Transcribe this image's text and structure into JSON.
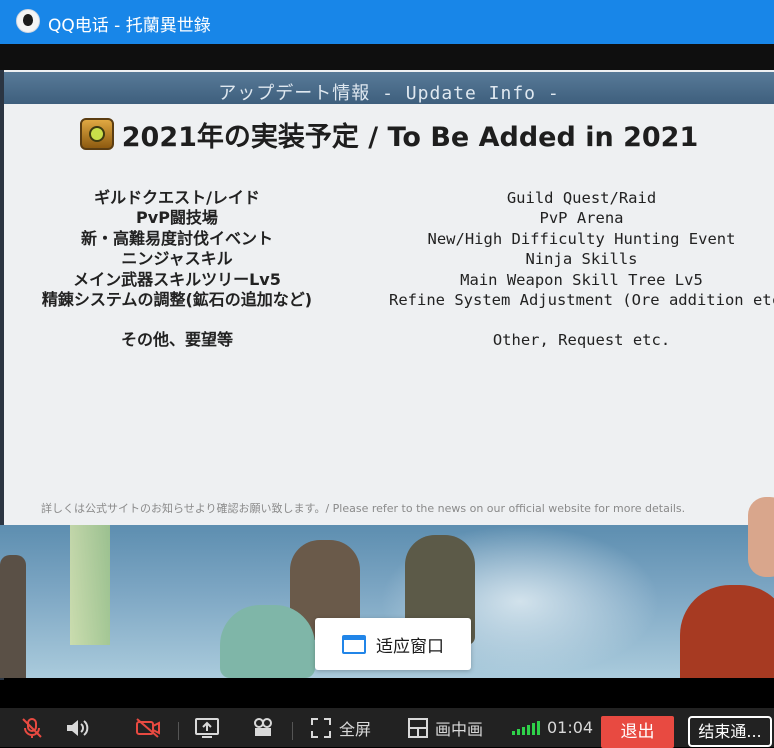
{
  "window": {
    "title": "QQ电话 - 托蘭異世錄"
  },
  "slide": {
    "header": "アップデート情報 - Update Info -",
    "title": "2021年の実装予定 / To Be Added in 2021",
    "items_jp": [
      "ギルドクエスト/レイド",
      "PvP闘技場",
      "新・高難易度討伐イベント",
      "ニンジャスキル",
      "メイン武器スキルツリーLv5",
      "精錬システムの調整(鉱石の追加など)"
    ],
    "items_en": [
      "Guild Quest/Raid",
      "PvP Arena",
      "New/High Difficulty Hunting Event",
      "Ninja Skills",
      "Main Weapon Skill Tree Lv5",
      "Refine System Adjustment (Ore addition etc.)"
    ],
    "other_jp": "その他、要望等",
    "other_en": "Other, Request etc.",
    "footnote": "詳しくは公式サイトのお知らせより確認お願い致します。/ Please refer to the news on our official website for more details."
  },
  "fit_window_label": "适应窗口",
  "toolbar": {
    "fullscreen_label": "全屏",
    "pip_label": "画中画",
    "duration": "01:04",
    "exit_label": "退出",
    "end_label": "结束通..."
  },
  "colors": {
    "titlebar": "#1886e8",
    "exit": "#e84a41",
    "signal": "#2fd14a"
  }
}
